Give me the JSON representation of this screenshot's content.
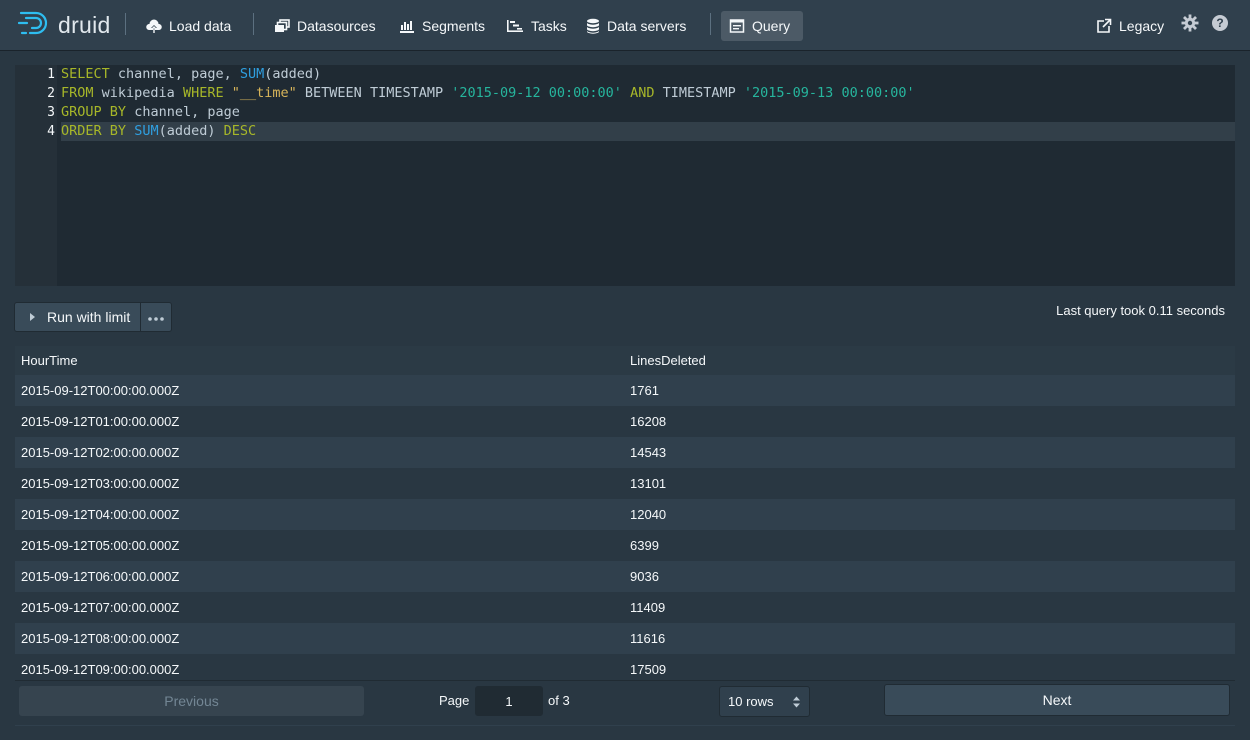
{
  "app": {
    "logo_text": "druid"
  },
  "nav": {
    "load_data": "Load data",
    "datasources": "Datasources",
    "segments": "Segments",
    "tasks": "Tasks",
    "data_servers": "Data servers",
    "query": "Query",
    "legacy": "Legacy"
  },
  "editor": {
    "line_numbers": [
      "1",
      "2",
      "3",
      "4"
    ],
    "lines": [
      "SELECT channel, page, SUM(added)",
      "FROM wikipedia WHERE \"__time\" BETWEEN TIMESTAMP '2015-09-12 00:00:00' AND TIMESTAMP '2015-09-13 00:00:00'",
      "GROUP BY channel, page",
      "ORDER BY SUM(added) DESC"
    ],
    "active_line": 4
  },
  "run": {
    "label": "Run with limit",
    "timing": "Last query took 0.11 seconds"
  },
  "results": {
    "columns": [
      "HourTime",
      "LinesDeleted"
    ],
    "rows": [
      [
        "2015-09-12T00:00:00.000Z",
        "1761"
      ],
      [
        "2015-09-12T01:00:00.000Z",
        "16208"
      ],
      [
        "2015-09-12T02:00:00.000Z",
        "14543"
      ],
      [
        "2015-09-12T03:00:00.000Z",
        "13101"
      ],
      [
        "2015-09-12T04:00:00.000Z",
        "12040"
      ],
      [
        "2015-09-12T05:00:00.000Z",
        "6399"
      ],
      [
        "2015-09-12T06:00:00.000Z",
        "9036"
      ],
      [
        "2015-09-12T07:00:00.000Z",
        "11409"
      ],
      [
        "2015-09-12T08:00:00.000Z",
        "11616"
      ],
      [
        "2015-09-12T09:00:00.000Z",
        "17509"
      ]
    ]
  },
  "pagination": {
    "previous": "Previous",
    "next": "Next",
    "page_label": "Page",
    "page_value": "1",
    "of_label": "of 3",
    "rows_option": "10 rows"
  },
  "colors": {
    "background": "#293742",
    "navbar": "#30404d",
    "editor": "#1f2a33",
    "logo": "#2ebdf0"
  }
}
